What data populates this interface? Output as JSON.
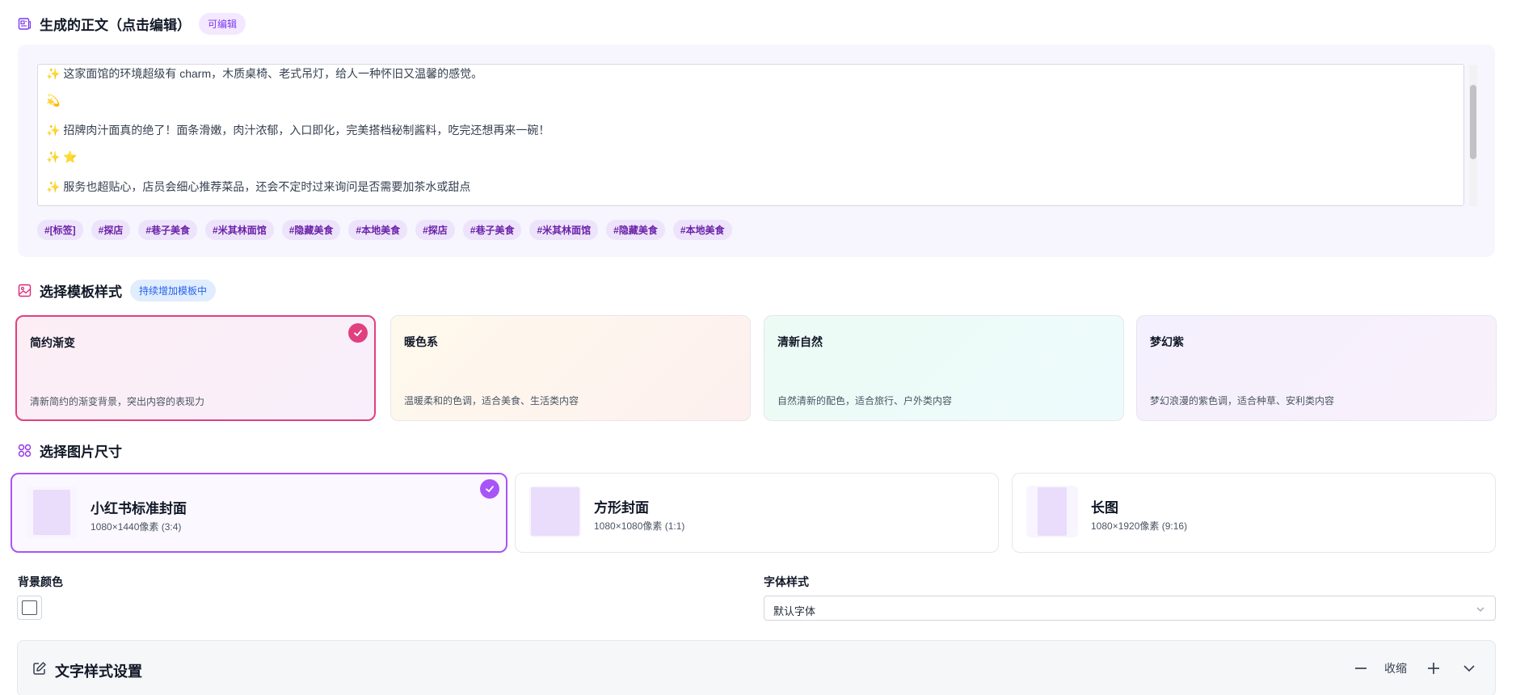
{
  "content_section": {
    "title": "生成的正文（点击编辑）",
    "badge": "可编辑",
    "lines": [
      "✨ 这家面馆的环境超级有 charm，木质桌椅、老式吊灯，给人一种怀旧又温馨的感觉。",
      "💫",
      "✨ 招牌肉汁面真的绝了！面条滑嫩，肉汁浓郁，入口即化，完美搭档秘制酱料，吃完还想再来一碗！",
      "✨ ⭐",
      "✨ 服务也超贴心，店员会细心推荐菜品，还会不定时过来询问是否需要加茶水或甜点"
    ],
    "tags": [
      "#[标签]",
      "#探店",
      "#巷子美食",
      "#米其林面馆",
      "#隐藏美食",
      "#本地美食",
      "#探店",
      "#巷子美食",
      "#米其林面馆",
      "#隐藏美食",
      "#本地美食"
    ]
  },
  "template_section": {
    "title": "选择模板样式",
    "badge": "持续增加模板中",
    "templates": [
      {
        "name": "简约渐变",
        "desc": "清新简约的渐变背景，突出内容的表现力",
        "selected": true
      },
      {
        "name": "暖色系",
        "desc": "温暖柔和的色调，适合美食、生活类内容",
        "selected": false
      },
      {
        "name": "清新自然",
        "desc": "自然清新的配色，适合旅行、户外类内容",
        "selected": false
      },
      {
        "name": "梦幻紫",
        "desc": "梦幻浪漫的紫色调，适合种草、安利类内容",
        "selected": false
      }
    ]
  },
  "size_section": {
    "title": "选择图片尺寸",
    "sizes": [
      {
        "name": "小红书标准封面",
        "dim": "1080×1440像素 (3:4)",
        "selected": true
      },
      {
        "name": "方形封面",
        "dim": "1080×1080像素 (1:1)",
        "selected": false
      },
      {
        "name": "长图",
        "dim": "1080×1920像素 (9:16)",
        "selected": false
      }
    ]
  },
  "background": {
    "label": "背景颜色",
    "color": "#ffffff"
  },
  "font": {
    "label": "字体样式",
    "value": "默认字体"
  },
  "text_style": {
    "title": "文字样式设置",
    "collapse_label": "收缩"
  },
  "colors": {
    "accent_pink": "#e0407f",
    "accent_purple": "#a855f7"
  }
}
